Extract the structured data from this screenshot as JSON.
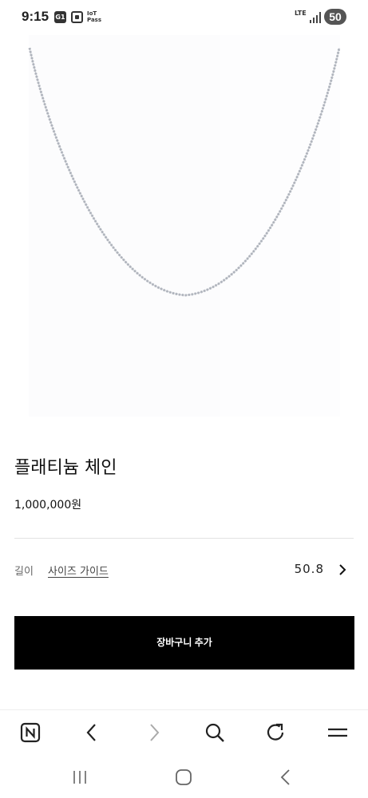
{
  "status_bar": {
    "time": "9:15",
    "notif_g1": "G1",
    "notif_iot_line1": "IoT",
    "notif_iot_line2": "Pass",
    "network": "LTE",
    "battery": "50"
  },
  "product": {
    "image_icon": "silver-chain-necklace",
    "name": "플래티늄 체인",
    "price": "1,000,000원"
  },
  "options": {
    "label": "길이",
    "size_guide": "사이즈 가이드",
    "value": "50.8"
  },
  "cart_button": "장바구니 추가",
  "browser_toolbar": {
    "icons": [
      "naver-icon",
      "back-icon",
      "forward-icon",
      "search-icon",
      "refresh-icon",
      "menu-icon"
    ]
  },
  "system_nav": {
    "icons": [
      "recent-apps-icon",
      "home-icon",
      "back-icon"
    ]
  },
  "colors": {
    "button_bg": "#000000",
    "button_text": "#ffffff",
    "chain": "#b8bcc4",
    "divider": "#e2e2e2"
  }
}
